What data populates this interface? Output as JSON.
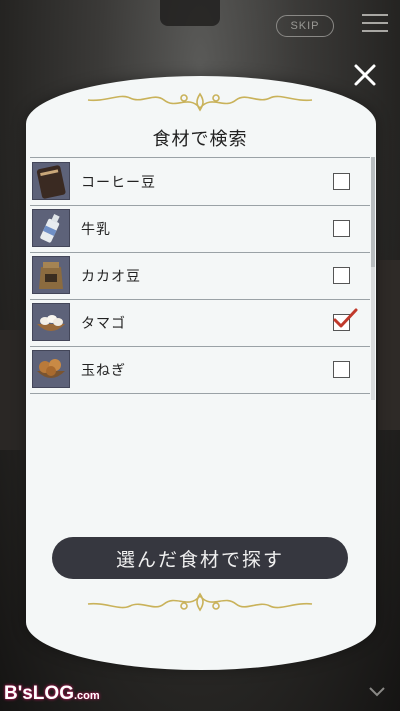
{
  "header": {
    "skip_label": "SKIP"
  },
  "panel": {
    "title": "食材で検索",
    "search_button_label": "選んだ食材で探す"
  },
  "ingredients": [
    {
      "name": "コーヒー豆",
      "icon": "coffee-beans-bag-icon",
      "checked": false
    },
    {
      "name": "牛乳",
      "icon": "milk-bottle-icon",
      "checked": false
    },
    {
      "name": "カカオ豆",
      "icon": "cacao-beans-sack-icon",
      "checked": false
    },
    {
      "name": "タマゴ",
      "icon": "eggs-basket-icon",
      "checked": true
    },
    {
      "name": "玉ねぎ",
      "icon": "onions-basket-icon",
      "checked": false
    }
  ],
  "watermark": {
    "text": "B'sLOG",
    "suffix": ".com"
  },
  "colors": {
    "check_mark": "#c0392b",
    "button": "#36373f",
    "panel": "#f4f7f7",
    "ornament": "#c9b25a"
  }
}
